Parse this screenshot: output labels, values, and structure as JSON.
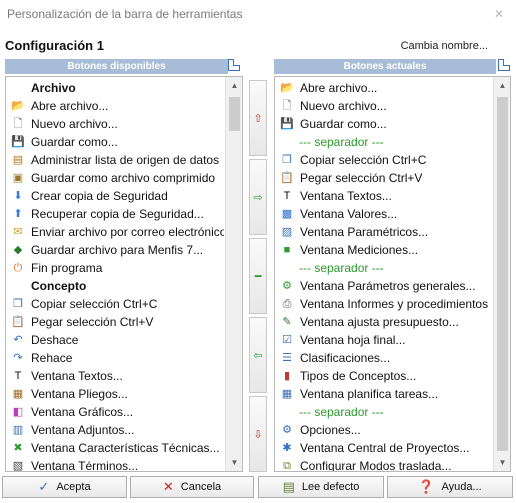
{
  "window": {
    "title": "Personalización de la barra de herramientas"
  },
  "config": {
    "name": "Configuración 1",
    "rename_label": "Cambia nombre..."
  },
  "available": {
    "header": "Botones disponibles",
    "items": [
      {
        "label": "Archivo",
        "icon": "",
        "type": "group"
      },
      {
        "label": "Abre archivo...",
        "icon": "open-folder",
        "type": "item"
      },
      {
        "label": "Nuevo archivo...",
        "icon": "new-file",
        "type": "item"
      },
      {
        "label": "Guardar como...",
        "icon": "save",
        "type": "item"
      },
      {
        "label": "Administrar lista de origen de datos",
        "icon": "manage-list",
        "type": "item"
      },
      {
        "label": "Guardar como archivo comprimido",
        "icon": "compressed",
        "type": "item"
      },
      {
        "label": "Crear copia de Seguridad",
        "icon": "backup",
        "type": "item"
      },
      {
        "label": "Recuperar copia de Seguridad...",
        "icon": "restore",
        "type": "item"
      },
      {
        "label": "Enviar archivo por correo electrónico",
        "icon": "mail",
        "type": "item"
      },
      {
        "label": "Guardar archivo para Menfis 7...",
        "icon": "menfis",
        "type": "item"
      },
      {
        "label": "Fin programa",
        "icon": "power",
        "type": "item"
      },
      {
        "label": "Concepto",
        "icon": "",
        "type": "group"
      },
      {
        "label": "Copiar selección Ctrl+C",
        "icon": "copy",
        "type": "item"
      },
      {
        "label": "Pegar selección  Ctrl+V",
        "icon": "paste",
        "type": "item"
      },
      {
        "label": "Deshace",
        "icon": "undo",
        "type": "item"
      },
      {
        "label": "Rehace",
        "icon": "redo",
        "type": "item"
      },
      {
        "label": "Ventana Textos...",
        "icon": "text-t",
        "type": "item"
      },
      {
        "label": "Ventana Pliegos...",
        "icon": "pliegos",
        "type": "item"
      },
      {
        "label": "Ventana Gráficos...",
        "icon": "graphics",
        "type": "item"
      },
      {
        "label": "Ventana Adjuntos...",
        "icon": "attachments",
        "type": "item"
      },
      {
        "label": "Ventana Características Técnicas...",
        "icon": "tech-x",
        "type": "item"
      },
      {
        "label": "Ventana Términos...",
        "icon": "terms",
        "type": "item"
      }
    ]
  },
  "current": {
    "header": "Botones actuales",
    "items": [
      {
        "label": "Abre archivo...",
        "icon": "open-folder",
        "type": "item"
      },
      {
        "label": "Nuevo archivo...",
        "icon": "new-file",
        "type": "item"
      },
      {
        "label": "Guardar como...",
        "icon": "save",
        "type": "item"
      },
      {
        "label": "--- separador ---",
        "icon": "",
        "type": "sep"
      },
      {
        "label": "Copiar selección Ctrl+C",
        "icon": "copy",
        "type": "item"
      },
      {
        "label": "Pegar selección  Ctrl+V",
        "icon": "paste",
        "type": "item"
      },
      {
        "label": "Ventana Textos...",
        "icon": "text-t",
        "type": "item"
      },
      {
        "label": "Ventana Valores...",
        "icon": "values",
        "type": "item"
      },
      {
        "label": "Ventana Paramétricos...",
        "icon": "parametric",
        "type": "item"
      },
      {
        "label": "Ventana Mediciones...",
        "icon": "cube",
        "type": "item"
      },
      {
        "label": "--- separador ---",
        "icon": "",
        "type": "sep"
      },
      {
        "label": "Ventana Parámetros generales...",
        "icon": "params",
        "type": "item"
      },
      {
        "label": "Ventana Informes y procedimientos",
        "icon": "printer",
        "type": "item"
      },
      {
        "label": "Ventana ajusta presupuesto...",
        "icon": "adjust",
        "type": "item"
      },
      {
        "label": "Ventana hoja final...",
        "icon": "final-sheet",
        "type": "item"
      },
      {
        "label": "Clasificaciones...",
        "icon": "classify",
        "type": "item"
      },
      {
        "label": "Tipos de Conceptos...",
        "icon": "concept-types",
        "type": "item"
      },
      {
        "label": "Ventana planifica tareas...",
        "icon": "planner",
        "type": "item"
      },
      {
        "label": "--- separador ---",
        "icon": "",
        "type": "sep"
      },
      {
        "label": "Opciones...",
        "icon": "options",
        "type": "item"
      },
      {
        "label": "Ventana Central de Proyectos...",
        "icon": "projects",
        "type": "item"
      },
      {
        "label": "Configurar Modos traslada...",
        "icon": "config-modes",
        "type": "item"
      }
    ]
  },
  "side_buttons": [
    {
      "icon": "move-up-arrow-icon",
      "glyph": "⇧",
      "color": "#c0392b"
    },
    {
      "icon": "add-arrow-icon",
      "glyph": "⇨",
      "color": "#2e9c2e"
    },
    {
      "icon": "separator-icon",
      "glyph": "━",
      "color": "#2e9c2e"
    },
    {
      "icon": "remove-arrow-icon",
      "glyph": "⇦",
      "color": "#2e9c2e"
    },
    {
      "icon": "move-down-arrow-icon",
      "glyph": "⇩",
      "color": "#c0392b"
    }
  ],
  "buttons": {
    "accept": "Acepta",
    "cancel": "Cancela",
    "load_default": "Lee defecto",
    "help": "Ayuda..."
  },
  "colors": {
    "header_bg": "#a7bcd6",
    "separator_text": "#2a9a2a"
  }
}
